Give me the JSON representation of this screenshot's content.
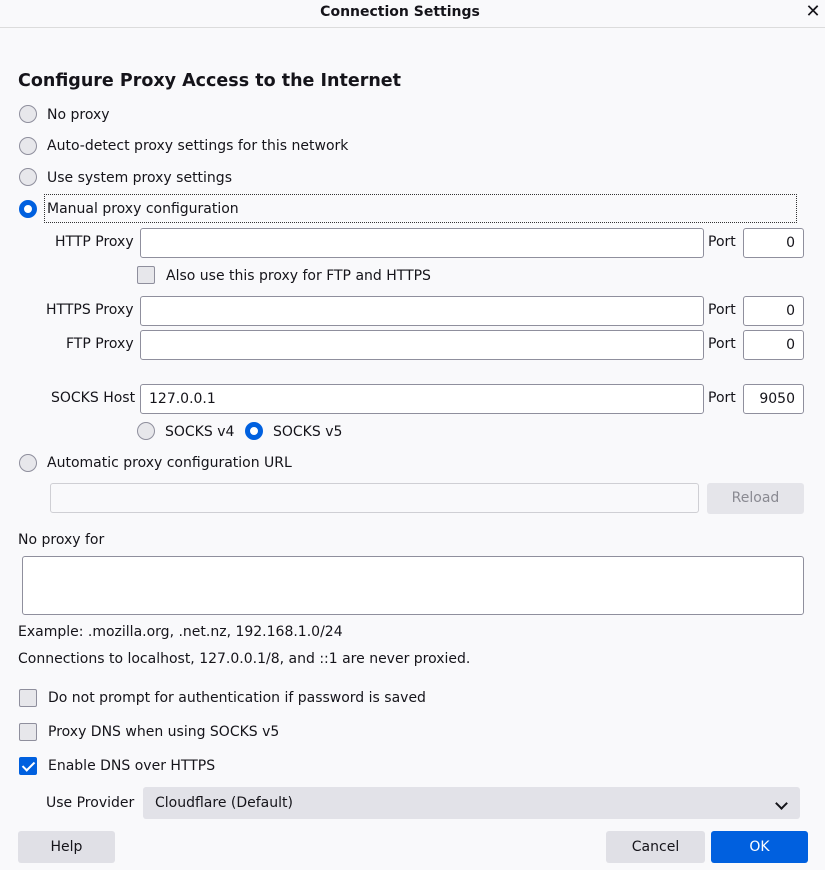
{
  "window": {
    "title": "Connection Settings",
    "close_icon": "close-icon"
  },
  "proxy": {
    "heading": "Configure Proxy Access to the Internet",
    "options": {
      "no_proxy": "No proxy",
      "auto_detect": "Auto-detect proxy settings for this network",
      "system": "Use system proxy settings",
      "manual": "Manual proxy configuration",
      "auto_url": "Automatic proxy configuration URL"
    },
    "selected": "manual",
    "http_label": "HTTP Proxy",
    "http_value": "",
    "http_port": "0",
    "also_use_label": "Also use this proxy for FTP and HTTPS",
    "https_label": "HTTPS Proxy",
    "https_value": "",
    "https_port": "0",
    "ftp_label": "FTP Proxy",
    "ftp_value": "",
    "ftp_port": "0",
    "socks_label": "SOCKS Host",
    "socks_value": "127.0.0.1",
    "socks_port": "9050",
    "port_label": "Port",
    "socks_v4": "SOCKS v4",
    "socks_v5": "SOCKS v5",
    "socks_selected": "v5",
    "auto_url_value": "",
    "reload_label": "Reload"
  },
  "no_proxy": {
    "label": "No proxy for",
    "value": "",
    "example": "Example: .mozilla.org, .net.nz, 192.168.1.0/24",
    "note": "Connections to localhost, 127.0.0.1/8, and ::1 are never proxied."
  },
  "options": {
    "no_prompt_auth": {
      "label": "Do not prompt for authentication if password is saved",
      "checked": false
    },
    "proxy_dns": {
      "label": "Proxy DNS when using SOCKS v5",
      "checked": false
    },
    "dns_https": {
      "label": "Enable DNS over HTTPS",
      "checked": true
    }
  },
  "provider": {
    "label": "Use Provider",
    "value": "Cloudflare (Default)"
  },
  "footer": {
    "help": "Help",
    "cancel": "Cancel",
    "ok": "OK"
  },
  "colors": {
    "accent": "#0060df",
    "background": "#f9f9fb",
    "button": "#e0e0e6"
  }
}
